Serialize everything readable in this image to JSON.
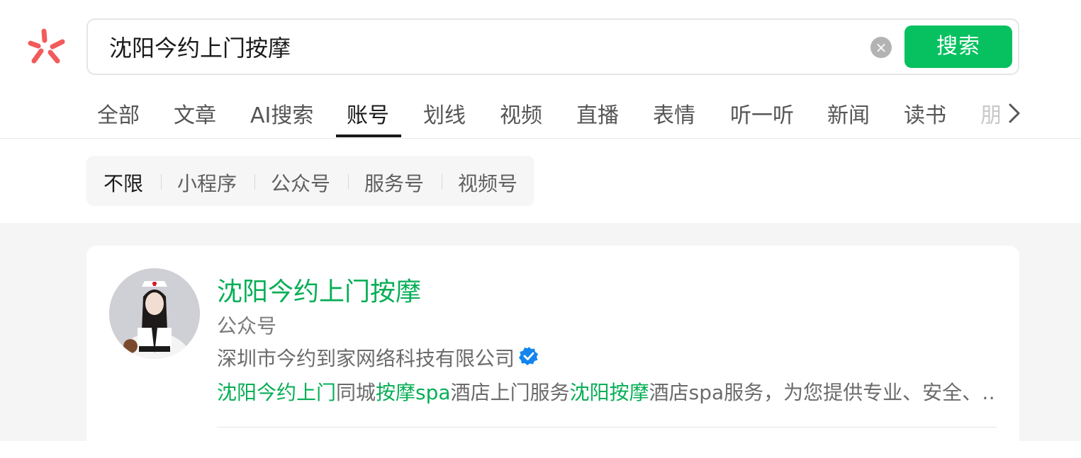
{
  "search": {
    "query": "沈阳今约上门按摩",
    "clear_label": "×",
    "button_label": "搜索"
  },
  "tabs": [
    {
      "label": "全部"
    },
    {
      "label": "文章"
    },
    {
      "label": "AI搜索"
    },
    {
      "label": "账号",
      "active": true
    },
    {
      "label": "划线"
    },
    {
      "label": "视频"
    },
    {
      "label": "直播"
    },
    {
      "label": "表情"
    },
    {
      "label": "听一听"
    },
    {
      "label": "新闻"
    },
    {
      "label": "读书"
    },
    {
      "label": "朋"
    }
  ],
  "filters": [
    {
      "label": "不限",
      "active": true
    },
    {
      "label": "小程序"
    },
    {
      "label": "公众号"
    },
    {
      "label": "服务号"
    },
    {
      "label": "视频号"
    }
  ],
  "result": {
    "title": "沈阳今约上门按摩",
    "type": "公众号",
    "owner": "深圳市今约到家网络科技有限公司",
    "desc": {
      "hl1": "沈阳今约上门",
      "t1": "同城",
      "hl2": "按摩",
      "hl3": "spa",
      "t2": "酒店上门服务",
      "hl4": "沈阳按摩",
      "t3": "酒店spa服务，为您提供专业、安全、…"
    }
  },
  "colors": {
    "accent_green": "#07c160",
    "highlight_green": "#06ae56",
    "logo_red": "#f25b5b",
    "verified_blue": "#1485ee"
  },
  "icons": {
    "logo": "wechat-search-logo-icon",
    "clear": "clear-icon",
    "more": "chevron-right-icon",
    "verified": "verified-badge-icon"
  }
}
